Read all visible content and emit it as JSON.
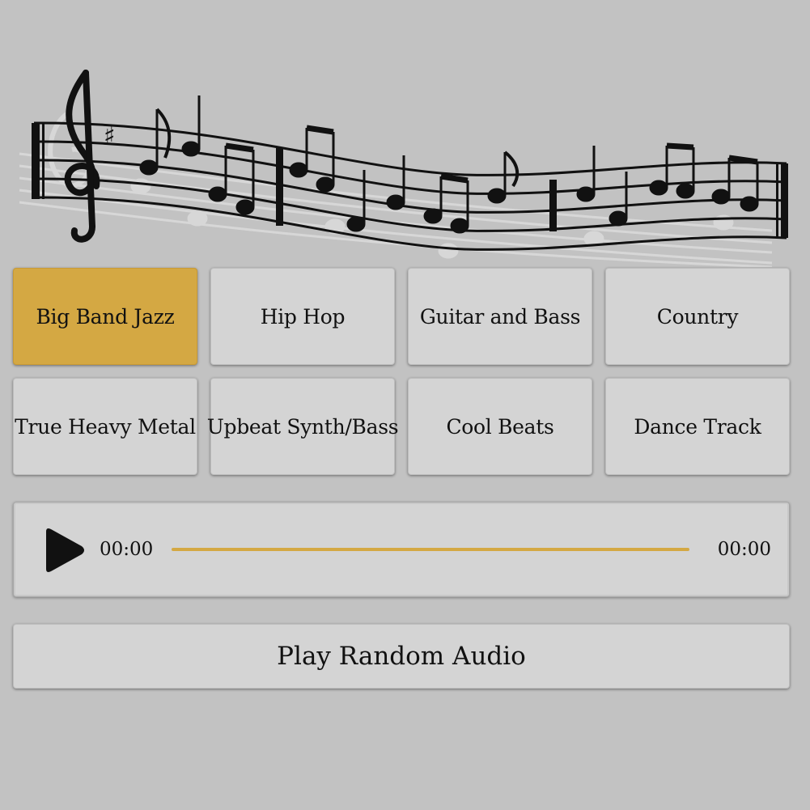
{
  "banner": {
    "image_name": "music-staff-notes-image"
  },
  "genres": [
    {
      "label": "Big Band Jazz",
      "active": true
    },
    {
      "label": "Hip Hop",
      "active": false
    },
    {
      "label": "Guitar and Bass",
      "active": false
    },
    {
      "label": "Country",
      "active": false
    },
    {
      "label": "True Heavy Metal",
      "active": false
    },
    {
      "label": "Upbeat Synth/Bass",
      "active": false
    },
    {
      "label": "Cool Beats",
      "active": false
    },
    {
      "label": "Dance Track",
      "active": false
    }
  ],
  "player": {
    "play_icon": "play-icon",
    "current_time": "00:00",
    "total_time": "00:00",
    "progress": 0
  },
  "random_button": {
    "label": "Play Random Audio"
  },
  "colors": {
    "background": "#c2c2c2",
    "button": "#d4d4d4",
    "accent": "#d4a843",
    "text": "#111111"
  }
}
